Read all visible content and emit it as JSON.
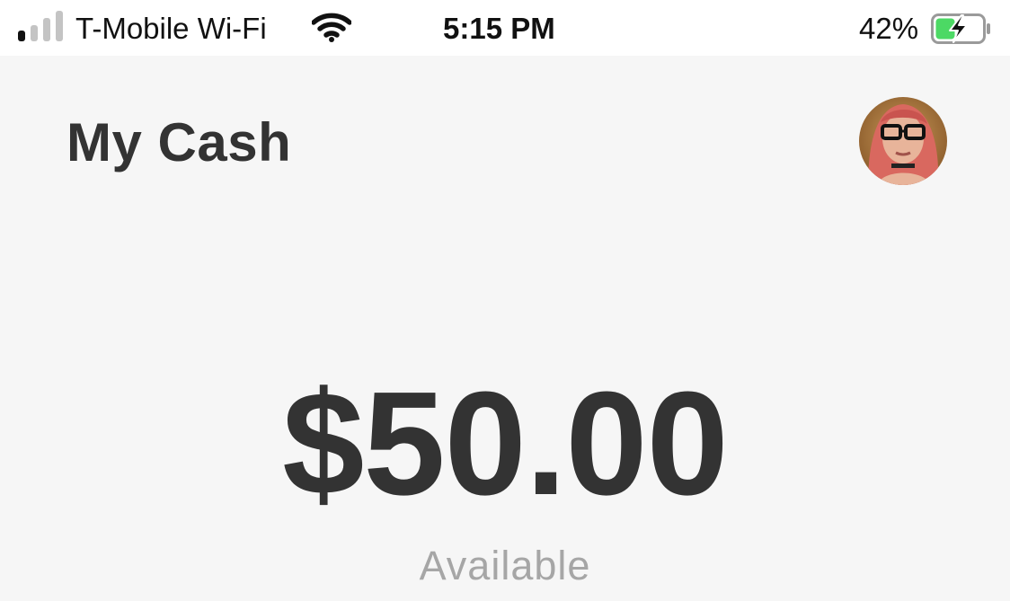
{
  "status_bar": {
    "carrier": "T-Mobile Wi-Fi",
    "time": "5:15 PM",
    "battery_percent": "42%",
    "battery_level": 0.42,
    "signal_bars_filled": 1,
    "signal_bars_total": 4,
    "charging": true,
    "icons": [
      "signal-strength-icon",
      "wifi-icon",
      "battery-charging-icon"
    ]
  },
  "header": {
    "title": "My Cash",
    "avatar": "profile-avatar"
  },
  "balance": {
    "amount": "$50.00",
    "label": "Available"
  },
  "colors": {
    "background": "#f6f6f6",
    "text_primary": "#333333",
    "text_secondary": "#a6a6a6",
    "battery_fill": "#4cd964"
  }
}
